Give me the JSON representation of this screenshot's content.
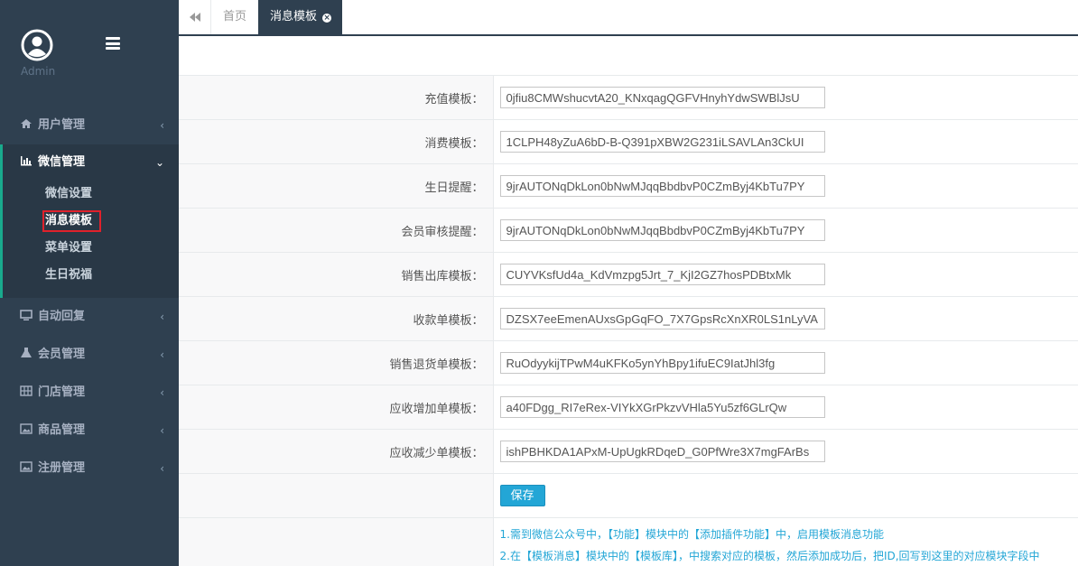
{
  "sidebar": {
    "admin_label": "Admin",
    "menu": [
      {
        "label": "用户管理",
        "icon": "home-icon"
      },
      {
        "label": "微信管理",
        "icon": "bar-chart-icon",
        "children": [
          {
            "label": "微信设置"
          },
          {
            "label": "消息模板"
          },
          {
            "label": "菜单设置"
          },
          {
            "label": "生日祝福"
          }
        ]
      },
      {
        "label": "自动回复",
        "icon": "monitor-icon"
      },
      {
        "label": "会员管理",
        "icon": "flask-icon"
      },
      {
        "label": "门店管理",
        "icon": "grid-icon"
      },
      {
        "label": "商品管理",
        "icon": "image-icon"
      },
      {
        "label": "注册管理",
        "icon": "image-icon"
      }
    ]
  },
  "tabs": {
    "home": "首页",
    "active": "消息模板"
  },
  "form": {
    "rows": [
      {
        "label": "充值模板：",
        "value": "0jfiu8CMWshucvtA20_KNxqagQGFVHnyhYdwSWBlJsU"
      },
      {
        "label": "消费模板：",
        "value": "1CLPH48yZuA6bD-B-Q391pXBW2G231iLSAVLAn3CkUI"
      },
      {
        "label": "生日提醒：",
        "value": "9jrAUTONqDkLon0bNwMJqqBbdbvP0CZmByj4KbTu7PY"
      },
      {
        "label": "会员审核提醒：",
        "value": "9jrAUTONqDkLon0bNwMJqqBbdbvP0CZmByj4KbTu7PY"
      },
      {
        "label": "销售出库模板：",
        "value": "CUYVKsfUd4a_KdVmzpg5Jrt_7_KjI2GZ7hosPDBtxMk"
      },
      {
        "label": "收款单模板：",
        "value": "DZSX7eeEmenAUxsGpGqFO_7X7GpsRcXnXR0LS1nLyVA"
      },
      {
        "label": "销售退货单模板：",
        "value": "RuOdyykijTPwM4uKFKo5ynYhBpy1ifuEC9IatJhl3fg"
      },
      {
        "label": "应收增加单模板：",
        "value": "a40FDgg_RI7eRex-VIYkXGrPkzvVHla5Yu5zf6GLrQw"
      },
      {
        "label": "应收减少单模板：",
        "value": "ishPBHKDA1APxM-UpUgkRDqeD_G0PfWre3X7mgFArBs"
      }
    ],
    "save_label": "保存",
    "notes": [
      "1.需到微信公众号中，【功能】模块中的【添加插件功能】中，启用模板消息功能",
      "2.在【模板消息】模块中的【模板库】，中搜索对应的模板，然后添加成功后，把ID,回写到这里的对应模块字段中"
    ]
  },
  "colors": {
    "sidebar_bg": "#2f4050",
    "accent": "#19aa8d",
    "link_blue": "#23a6d6",
    "highlight_red": "#e0212b"
  }
}
